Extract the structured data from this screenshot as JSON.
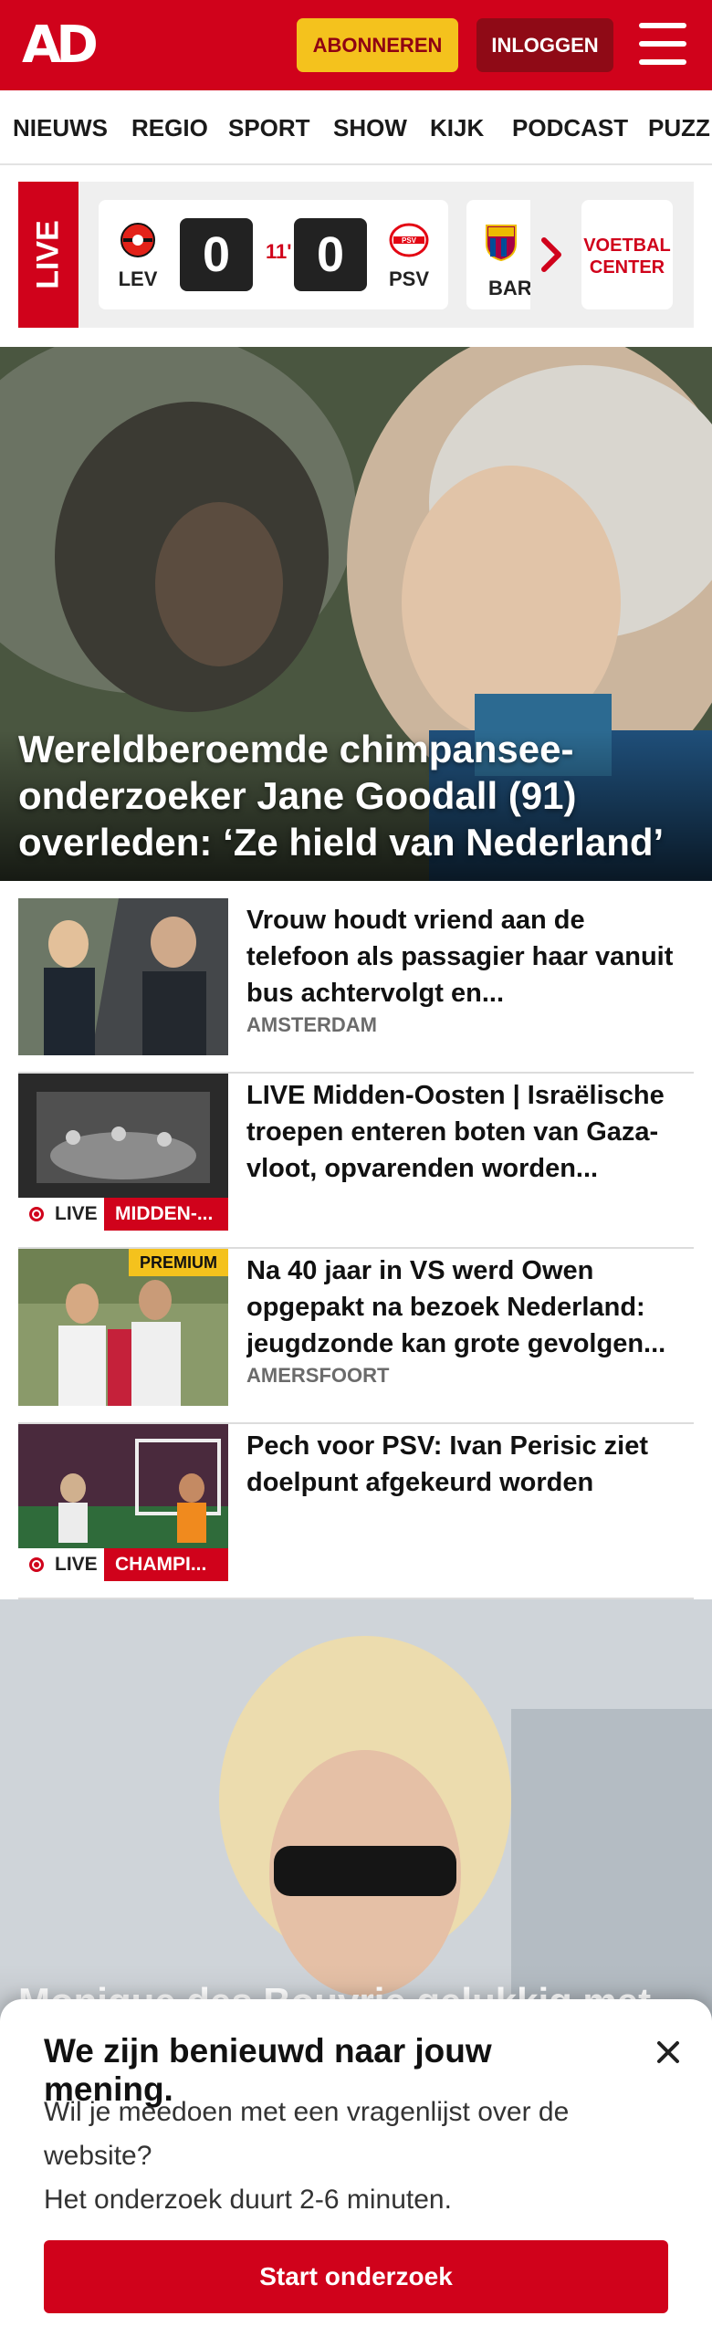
{
  "header": {
    "logo": "AD",
    "subscribe_label": "ABONNEREN",
    "login_label": "INLOGGEN",
    "brand_color": "#d0021b",
    "subscribe_color": "#f4c21d"
  },
  "nav": {
    "items": [
      "NIEUWS",
      "REGIO",
      "SPORT",
      "SHOW",
      "KIJK",
      "PODCAST",
      "PUZZ"
    ]
  },
  "live_scores": {
    "live_label": "LIVE",
    "match": {
      "home": "LEV",
      "away": "PSV",
      "home_score": "0",
      "away_score": "0",
      "minute": "11'"
    },
    "next_team": "BAR",
    "voetbal_center_label": "VOETBAL CENTER"
  },
  "hero": {
    "title": "Wereldberoemde chimpansee-onderzoeker Jane Goodall (91) overleden: ‘Ze hield van Nederland’"
  },
  "articles": [
    {
      "title": "Vrouw houdt vriend aan de telefoon als passagier haar vanuit bus achtervolgt en...",
      "tag": "AMSTERDAM"
    },
    {
      "title": "LIVE Midden-Oosten | Israëlische troepen enteren boten van Gaza-vloot, opvarenden worden...",
      "live_label": "LIVE",
      "category": "MIDDEN-..."
    },
    {
      "title": "Na 40 jaar in VS werd Owen opgepakt na bezoek Nederland: jeugdzonde kan grote gevolgen...",
      "tag": "AMERSFOORT",
      "badge": "PREMIUM"
    },
    {
      "title": "Pech voor PSV: Ivan Perisic ziet doelpunt afgekeurd worden",
      "live_label": "LIVE",
      "category": "CHAMPI..."
    }
  ],
  "hero2": {
    "title": "Monique des Bouvrie gelukkig met..."
  },
  "survey": {
    "title": "We zijn benieuwd naar jouw mening.",
    "question": "Wil je meedoen met een vragenlijst over de website?",
    "duration": "Het onderzoek duurt 2-6 minuten.",
    "button_label": "Start onderzoek"
  }
}
